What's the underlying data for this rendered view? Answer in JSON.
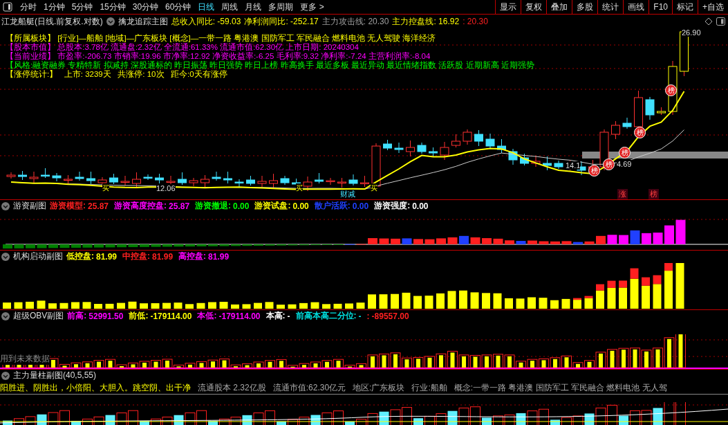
{
  "toolbar": {
    "tabs": [
      {
        "label": "分时",
        "selected": false
      },
      {
        "label": "1分钟",
        "selected": false
      },
      {
        "label": "5分钟",
        "selected": false
      },
      {
        "label": "15分钟",
        "selected": false
      },
      {
        "label": "30分钟",
        "selected": false
      },
      {
        "label": "60分钟",
        "selected": false
      },
      {
        "label": "日线",
        "selected": true
      },
      {
        "label": "周线",
        "selected": false
      },
      {
        "label": "月线",
        "selected": false
      },
      {
        "label": "多周期",
        "selected": false
      },
      {
        "label": "更多 >",
        "selected": false
      }
    ],
    "buttons": [
      "显示",
      "复权",
      "叠加",
      "多股",
      "统计",
      "画线",
      "F10",
      "标记",
      "+自选"
    ]
  },
  "header": {
    "title": "江龙船艇(日线.前复权.对数)",
    "indicator": "擒龙追踪主图",
    "metrics": [
      {
        "label": "总收入同比:",
        "value": "-59.03",
        "color": "#ffff00"
      },
      {
        "label": "净利润同比:",
        "value": "-252.17",
        "color": "#ffff00"
      },
      {
        "label": "主力攻击线:",
        "value": "20.30",
        "color": "#a0a0a0"
      },
      {
        "label": "主力控盘线:",
        "value": "16.92",
        "color": "#ffff00"
      },
      {
        "label": ":",
        "value": "20.30",
        "color": "#ff2020"
      }
    ]
  },
  "main_chart": {
    "info_lines": [
      {
        "text": "【所属板块】 [行业]—船舶 [地域]—广东板块 [概念]—一带一路 粤港澳 国防军工 军民融合 燃料电池 无人驾驶 海洋经济",
        "color": "#ffff00"
      },
      {
        "text": "【股本市值】 总股本:3.78亿 流通盘:2.32亿 全流通:61.33% 流通市值:62.30亿 上市日期: 20240304",
        "color": "#ff00ff"
      },
      {
        "text": "【当前业绩】 市盈率:-206.73 市销率:19.96 市净率:12.92 净资收益率:-6.25 毛利率:9.32 净利率:-7.24 主营利润率:-8.04",
        "color": "#ff00ff"
      },
      {
        "text": "【风格:融资融券 专精特新 拟减持 深股通标的 昨日振荡 昨日强势 昨日上榜 昨高换手 最近多板 最近异动 最近情绪指数 活跃股 近期新高 近期强势",
        "color": "#00ff00"
      },
      {
        "text": "【涨停统计:】   上市: 3239天   共涨停: 10次   距今:0天有涨停",
        "color": "#ffff00"
      }
    ],
    "annotations": [
      {
        "text": "26.90",
        "kind": "price"
      },
      {
        "text": "14.1",
        "kind": "price"
      },
      {
        "text": "4.69",
        "kind": "price"
      },
      {
        "text": "12.06",
        "kind": "price"
      },
      {
        "text": "榜",
        "kind": "badge"
      },
      {
        "text": "榜",
        "kind": "badge"
      },
      {
        "text": "榜",
        "kind": "badge"
      },
      {
        "text": "榜",
        "kind": "badge"
      },
      {
        "text": "榜",
        "kind": "badge"
      },
      {
        "text": "买",
        "kind": "buy"
      },
      {
        "text": "买",
        "kind": "buy"
      },
      {
        "text": "买",
        "kind": "buy"
      },
      {
        "text": "财减",
        "kind": "event"
      },
      {
        "text": "涨",
        "kind": "tag"
      },
      {
        "text": "榜",
        "kind": "tag"
      }
    ]
  },
  "panels": [
    {
      "title": "游资副图",
      "metrics": [
        {
          "label": "游资模型:",
          "value": "25.87",
          "color": "#ff2020"
        },
        {
          "label": "游资高度控盘:",
          "value": "25.87",
          "color": "#ff00ff"
        },
        {
          "label": "游资撤退:",
          "value": "0.00",
          "color": "#00ff00"
        },
        {
          "label": "游资试盘:",
          "value": "0.00",
          "color": "#ffff00"
        },
        {
          "label": "散户活跃:",
          "value": "0.00",
          "color": "#2040ff"
        },
        {
          "label": "游资强度:",
          "value": "0.00",
          "color": "#ffffff"
        }
      ]
    },
    {
      "title": "机构启动副图",
      "metrics": [
        {
          "label": "低控盘:",
          "value": "81.99",
          "color": "#ffff00"
        },
        {
          "label": "中控盘:",
          "value": "81.99",
          "color": "#ff2020"
        },
        {
          "label": "高控盘:",
          "value": "81.99",
          "color": "#ff00ff"
        }
      ]
    },
    {
      "title": "超级OBV副图",
      "metrics": [
        {
          "label": "前高:",
          "value": "52991.50",
          "color": "#ff00ff"
        },
        {
          "label": "前低:",
          "value": "-179114.00",
          "color": "#ffff00"
        },
        {
          "label": "本低:",
          "value": "-179114.00",
          "color": "#ff00ff"
        },
        {
          "label": "本高:",
          "value": "-",
          "color": "#ffffff"
        },
        {
          "label": "前高本高二分位:",
          "value": "-",
          "color": "#00e0e0"
        },
        {
          "label": ":",
          "value": "-89557.00",
          "color": "#ff2020"
        }
      ],
      "note": "用到未来数据"
    },
    {
      "title": "主力量柱副图(40,5,55)",
      "motto": "阳胜进、阴胜出，小倍阳、大胆入。跳空阴、出干净",
      "facts": [
        "流通股本 2.32亿股",
        "流通市值:62.30亿元",
        "地区:广东板块",
        "行业:船舶",
        "概念:一带一路 粤港澳 国防军工 军民融合 燃料电池 无人驾"
      ]
    }
  ]
}
